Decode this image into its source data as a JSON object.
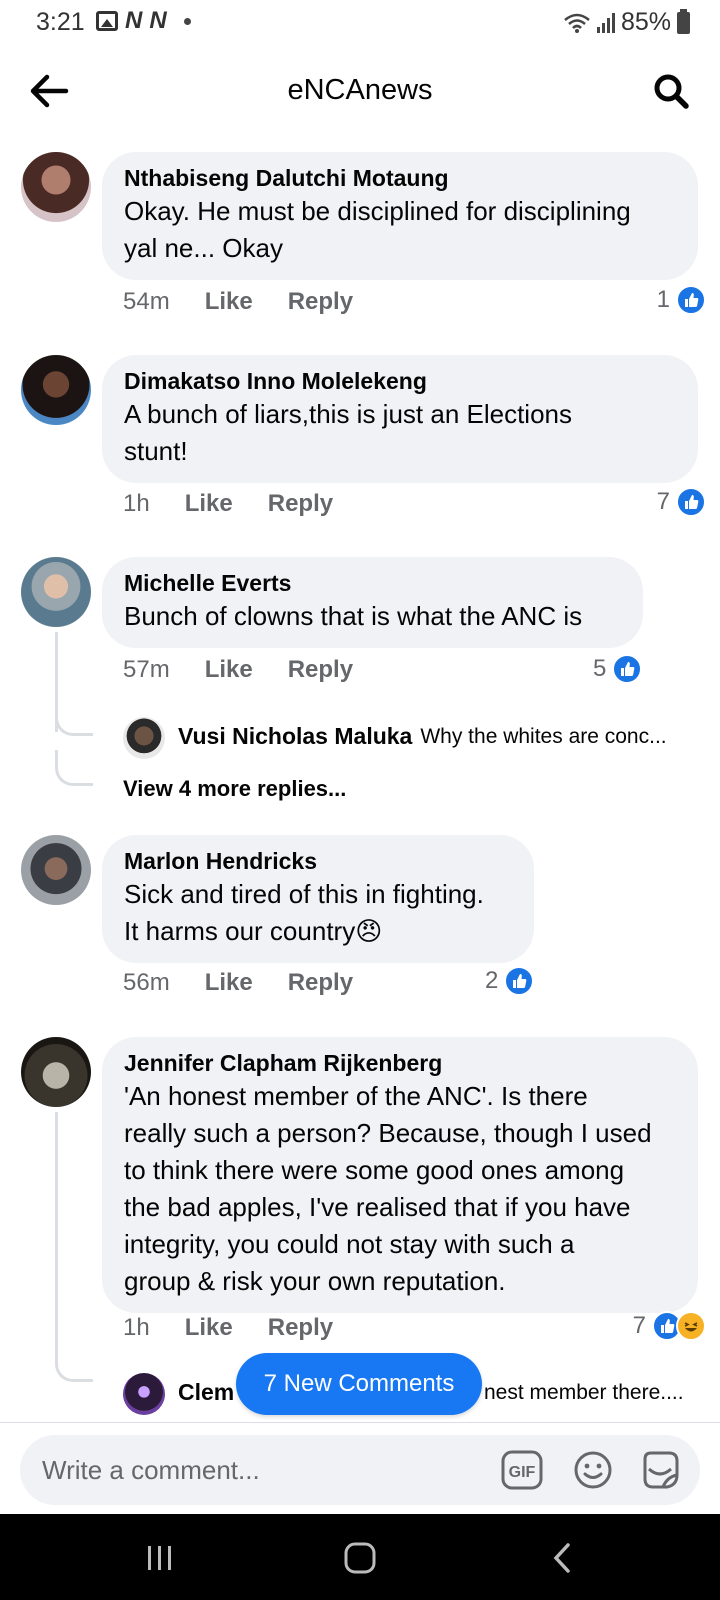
{
  "status_bar": {
    "time": "3:21",
    "notif_n": "N",
    "battery": "85%"
  },
  "header": {
    "title": "eNCAnews"
  },
  "comments": [
    {
      "author": "Nthabiseng Dalutchi Motaung",
      "text_lines": [
        "Okay. He must be disciplined for disciplining",
        "yal ne... Okay"
      ],
      "time": "54m",
      "like": "Like",
      "reply": "Reply",
      "reactions": "1"
    },
    {
      "author": "Dimakatso Inno Molelekeng",
      "text_lines": [
        "A bunch of liars,this is just an Elections",
        "stunt!"
      ],
      "time": "1h",
      "like": "Like",
      "reply": "Reply",
      "reactions": "7"
    },
    {
      "author": "Michelle Everts",
      "text_lines": [
        "Bunch of clowns that is what the ANC is"
      ],
      "time": "57m",
      "like": "Like",
      "reply": "Reply",
      "reactions": "5",
      "reply_preview": {
        "author": "Vusi Nicholas Maluka",
        "snippet": "Why the whites are conc..."
      },
      "view_more": "View 4 more replies..."
    },
    {
      "author": "Marlon Hendricks",
      "text_lines": [
        "Sick and tired of this in fighting.",
        "It harms our country"
      ],
      "emoji": "😠",
      "time": "56m",
      "like": "Like",
      "reply": "Reply",
      "reactions": "2"
    },
    {
      "author": "Jennifer Clapham Rijkenberg",
      "text_lines": [
        "'An honest member of the ANC'. Is there",
        "really such a person? Because, though I used",
        "to think there were some good ones among",
        "the bad apples, I've realised that if you have",
        "integrity, you could not stay with such a",
        "group & risk your own reputation."
      ],
      "time": "1h",
      "like": "Like",
      "reply": "Reply",
      "reactions": "7",
      "reply_preview": {
        "author": "Clem",
        "snippet": "nest member there...."
      }
    }
  ],
  "new_comments_pill": "7 New Comments",
  "composer": {
    "placeholder": "Write a comment...",
    "gif_label": "GIF"
  },
  "colors": {
    "accent": "#1877f2",
    "bubble": "#f0f2f5",
    "meta": "#65676b"
  }
}
